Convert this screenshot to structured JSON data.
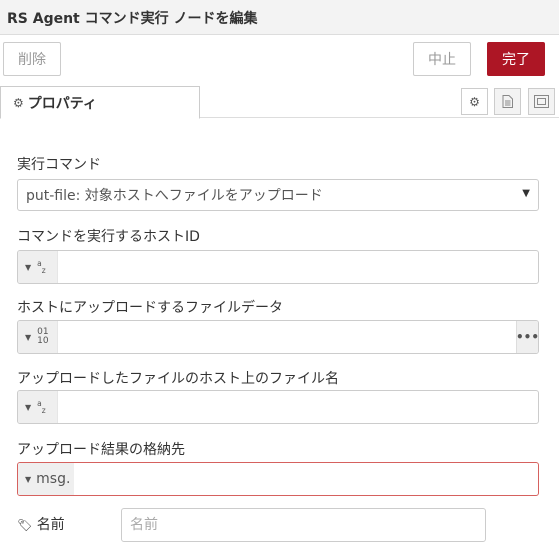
{
  "header": {
    "title": "RS Agent コマンド実行 ノードを編集"
  },
  "buttons": {
    "delete": "削除",
    "cancel": "中止",
    "done": "完了"
  },
  "tabs": {
    "properties_label": "プロパティ",
    "properties_icon": "gear-icon",
    "side_icons": [
      "gear-icon",
      "document-icon",
      "frame-icon"
    ]
  },
  "form": {
    "command": {
      "label": "実行コマンド",
      "value": "put-file: 対象ホストへファイルをアップロード"
    },
    "host_id": {
      "label": "コマンドを実行するホストID",
      "type_icon": "az",
      "value": ""
    },
    "file_data": {
      "label": "ホストにアップロードするファイルデータ",
      "type_icon": "01/10",
      "value": "",
      "expand": "•••"
    },
    "file_name": {
      "label": "アップロードしたファイルのホスト上のファイル名",
      "type_icon": "az",
      "value": ""
    },
    "result_dest": {
      "label": "アップロード結果の格納先",
      "type_label": "msg.",
      "value": ""
    },
    "name": {
      "label": "名前",
      "placeholder": "名前",
      "icon": "tag-icon"
    }
  },
  "colors": {
    "primary": "#ad1625",
    "error_border": "#d6615e"
  }
}
